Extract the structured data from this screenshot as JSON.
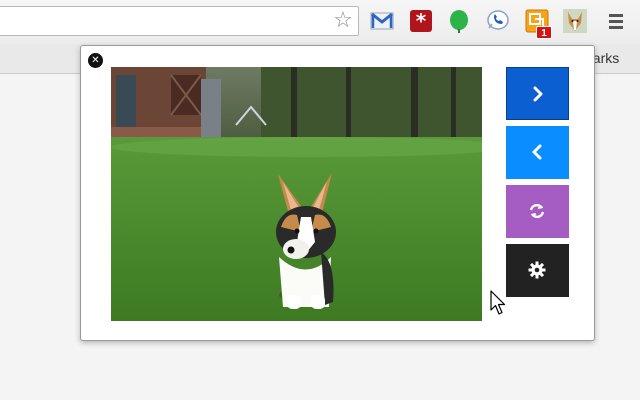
{
  "browser": {
    "bookmarks_bar": {
      "partial_item_label": "harks"
    },
    "toolbar": {
      "icons": [
        "gmail-icon",
        "lastpass-icon",
        "evernote-leaf-icon",
        "phone-call-icon",
        "translate-icon",
        "corgi-extension-icon"
      ],
      "notification_badge": "1"
    }
  },
  "popup": {
    "image_subject": "corgi-puppy-photo",
    "controls": [
      {
        "name": "next-button",
        "icon": "chevron-right-icon",
        "color": "#0b5fd0"
      },
      {
        "name": "previous-button",
        "icon": "chevron-left-icon",
        "color": "#0a8dff"
      },
      {
        "name": "refresh-button",
        "icon": "refresh-icon",
        "color": "#a55dc4"
      },
      {
        "name": "settings-button",
        "icon": "gear-icon",
        "color": "#222222"
      }
    ]
  }
}
